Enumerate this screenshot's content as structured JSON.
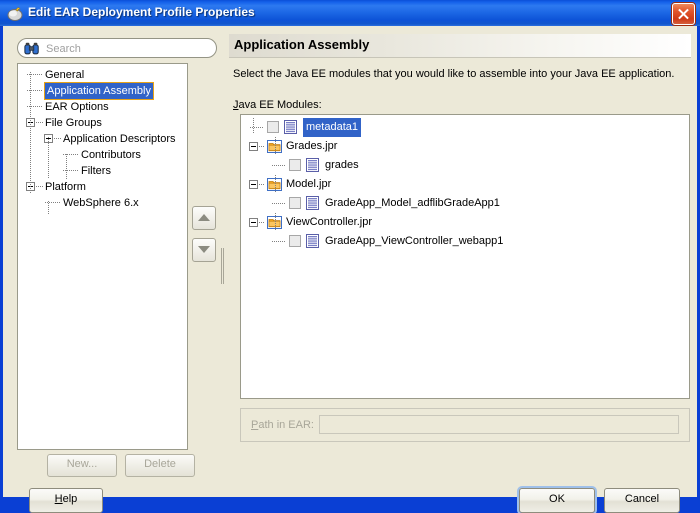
{
  "window": {
    "title": "Edit EAR Deployment Profile Properties",
    "icon": "application-icon",
    "close_label": "Close"
  },
  "search": {
    "placeholder": "Search",
    "icon": "binoculars-icon"
  },
  "nav_tree": {
    "items": [
      {
        "label": "General",
        "level": 0,
        "selected": false,
        "expander": false
      },
      {
        "label": "Application Assembly",
        "level": 0,
        "selected": true,
        "expander": false
      },
      {
        "label": "EAR Options",
        "level": 0,
        "selected": false,
        "expander": false
      },
      {
        "label": "File Groups",
        "level": 0,
        "selected": false,
        "expander": true
      },
      {
        "label": "Application Descriptors",
        "level": 1,
        "selected": false,
        "expander": true
      },
      {
        "label": "Contributors",
        "level": 2,
        "selected": false,
        "expander": false
      },
      {
        "label": "Filters",
        "level": 2,
        "selected": false,
        "expander": false
      },
      {
        "label": "Platform",
        "level": 0,
        "selected": false,
        "expander": true
      },
      {
        "label": "WebSphere 6.x",
        "level": 1,
        "selected": false,
        "expander": false
      }
    ]
  },
  "left_buttons": {
    "new_label": "New...",
    "new_mnemonic": "N",
    "delete_label": "Delete",
    "delete_mnemonic": "e",
    "move_up": "Move Up",
    "move_down": "Move Down"
  },
  "pane": {
    "title": "Application Assembly",
    "description": "Select the Java EE modules that you would like to assemble into your Java EE application.",
    "modules_label": "Java EE Modules:",
    "modules_mnemonic": "J"
  },
  "modules": [
    {
      "label": "metadata1",
      "level": 0,
      "icon": "document-icon",
      "checkbox": true,
      "expander": false,
      "selected": true
    },
    {
      "label": "Grades.jpr",
      "level": 0,
      "icon": "folder-icon",
      "checkbox": false,
      "expander": true,
      "selected": false
    },
    {
      "label": "grades",
      "level": 1,
      "icon": "document-icon",
      "checkbox": true,
      "expander": false,
      "selected": false
    },
    {
      "label": "Model.jpr",
      "level": 0,
      "icon": "folder-icon",
      "checkbox": false,
      "expander": true,
      "selected": false
    },
    {
      "label": "GradeApp_Model_adflibGradeApp1",
      "level": 1,
      "icon": "document-icon",
      "checkbox": true,
      "expander": false,
      "selected": false
    },
    {
      "label": "ViewController.jpr",
      "level": 0,
      "icon": "folder-icon",
      "checkbox": false,
      "expander": true,
      "selected": false
    },
    {
      "label": "GradeApp_ViewController_webapp1",
      "level": 1,
      "icon": "document-icon",
      "checkbox": true,
      "expander": false,
      "selected": false
    }
  ],
  "path_in_ear": {
    "label": "Path in EAR:",
    "mnemonic": "P",
    "value": ""
  },
  "footer": {
    "help_label": "Help",
    "help_mnemonic": "H",
    "ok_label": "OK",
    "cancel_label": "Cancel"
  },
  "colors": {
    "titlebar": "#1461ea",
    "dialog_bg": "#ece9d8",
    "selection": "#3163c8",
    "selection_outline": "#e8a317",
    "close_button": "#d4451f",
    "folder_icon": "#f6a821",
    "disabled_text": "#a8a699"
  }
}
